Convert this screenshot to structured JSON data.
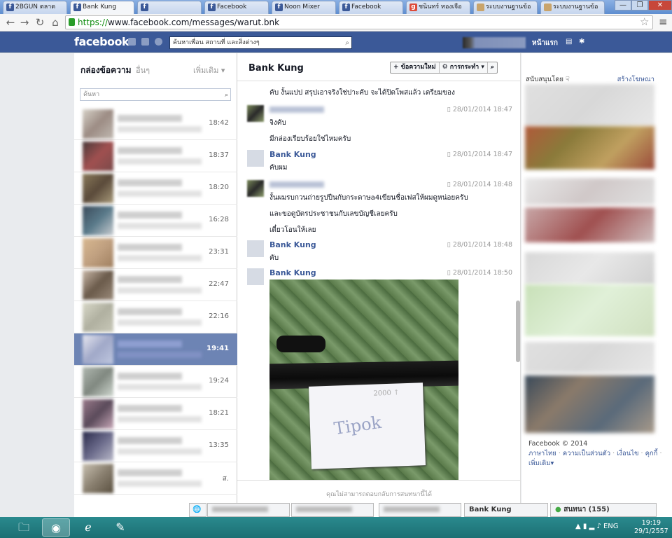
{
  "tabs": [
    {
      "label": "2BGUN ตลาด",
      "active": false,
      "fav": "f"
    },
    {
      "label": "Bank Kung",
      "active": true,
      "fav": "f"
    },
    {
      "label": "",
      "active": false,
      "fav": "f"
    },
    {
      "label": "Facebook",
      "active": false,
      "fav": "f"
    },
    {
      "label": "Noon Mixer",
      "active": false,
      "fav": "f"
    },
    {
      "label": "Facebook",
      "active": false,
      "fav": "f"
    },
    {
      "label": "ชนินทร์ ทองเจือ",
      "active": false,
      "fav": "g"
    },
    {
      "label": "ระบบงานฐานข้อ",
      "active": false,
      "fav": "d"
    },
    {
      "label": "ระบบงานฐานข้อ",
      "active": false,
      "fav": "d"
    }
  ],
  "browser": {
    "url_scheme": "https://",
    "url_rest": "www.facebook.com/messages/warut.bnk"
  },
  "fb": {
    "logo": "facebook",
    "search_placeholder": "ค้นหาเพื่อน สถานที่ และสิ่งต่างๆ",
    "home_label": "หน้าแรก"
  },
  "left": {
    "title": "กล่องข้อความ",
    "other": "อื่นๆ",
    "more": "เพิ่มเติม ▾",
    "search_placeholder": "ค้นหา",
    "threads": [
      {
        "time": "18:42",
        "colors": [
          "#d7d2c8",
          "#9c8c84",
          "#c0b8b0"
        ]
      },
      {
        "time": "18:37",
        "colors": [
          "#4a3a3a",
          "#a05050",
          "#7a4a4a"
        ]
      },
      {
        "time": "18:20",
        "colors": [
          "#8a7a5a",
          "#5a4a3a",
          "#a89a7a"
        ]
      },
      {
        "time": "16:28",
        "colors": [
          "#3a4a5a",
          "#5a7a8a",
          "#c8ccd0"
        ]
      },
      {
        "time": "23:31",
        "colors": [
          "#d8b890",
          "#c0a080",
          "#a08060"
        ]
      },
      {
        "time": "22:47",
        "colors": [
          "#cab8a8",
          "#6a5a4a",
          "#9a8a7a"
        ]
      },
      {
        "time": "22:16",
        "colors": [
          "#d8d8c8",
          "#b0b0a0",
          "#c8c8b8"
        ]
      },
      {
        "time": "19:41",
        "colors": [
          "#e8e8f0",
          "#a0a8c8",
          "#c0c8e0"
        ],
        "selected": true
      },
      {
        "time": "19:24",
        "colors": [
          "#b0b8b0",
          "#808880",
          "#d0d8d0"
        ]
      },
      {
        "time": "18:21",
        "colors": [
          "#9a7a8a",
          "#5a4a5a",
          "#c8a8b8"
        ]
      },
      {
        "time": "13:35",
        "colors": [
          "#2a2a4a",
          "#6a6a8a",
          "#b8b8c8"
        ]
      },
      {
        "time": "ส.",
        "colors": [
          "#c8c0b0",
          "#8a8070",
          "#5a5040"
        ]
      }
    ]
  },
  "conv": {
    "title": "Bank Kung",
    "new_msg": "+ ข้อความใหม่",
    "actions": "⚙ การกระทำ ▾",
    "footer": "คุณไม่สามารถตอบกลับการสนทนานี้ได้",
    "msgs": [
      {
        "name": "",
        "blur": false,
        "date": "",
        "lines": [
          "คับ งั้นแปป สรุปเอาจริงใช่ปาะคับ จะได้ปิดโพสแล้ว เตรียมของ"
        ]
      },
      {
        "name": "",
        "blur": true,
        "date": "28/01/2014 18:47",
        "lines": [
          "จิงคับ",
          "มีกล่องเรียบร้อยใช่ไหมครับ"
        ]
      },
      {
        "name": "Bank Kung",
        "blur": false,
        "date": "28/01/2014 18:47",
        "lines": [
          "คับผม"
        ]
      },
      {
        "name": "",
        "blur": true,
        "date": "28/01/2014 18:48",
        "lines": [
          "งั้นผมรบกวนถ่ายรูปปืนกับกระดาษa4เขียนชื่อเฟสให้ผมดูหน่อยครับ",
          "และขอดูบัตรประชาชนกับเลขบัญชีเลยครับ",
          "เดี๋ยวโอนให้เลย"
        ]
      },
      {
        "name": "Bank Kung",
        "blur": false,
        "date": "28/01/2014 18:48",
        "lines": [
          "คับ"
        ]
      },
      {
        "name": "Bank Kung",
        "blur": false,
        "date": "28/01/2014 18:50",
        "lines": [],
        "photo": true
      }
    ]
  },
  "photo_note": {
    "line1": "2000 ↑",
    "line2": "Tipok"
  },
  "right": {
    "sponsored": "สนับสนุนโดย ☟",
    "create_ad": "สร้างโฆษณา",
    "copyright": "Facebook © 2014",
    "links": [
      "ภาษาไทย",
      "ความเป็นส่วนตัว",
      "เงื่อนไข",
      "คุกกี้",
      "เพิ่มเติม▾"
    ]
  },
  "chat": {
    "active": "Bank Kung",
    "status": "สนทนา (155)"
  },
  "tray": {
    "lang": "ENG",
    "time": "19:19",
    "date": "29/1/2557"
  }
}
